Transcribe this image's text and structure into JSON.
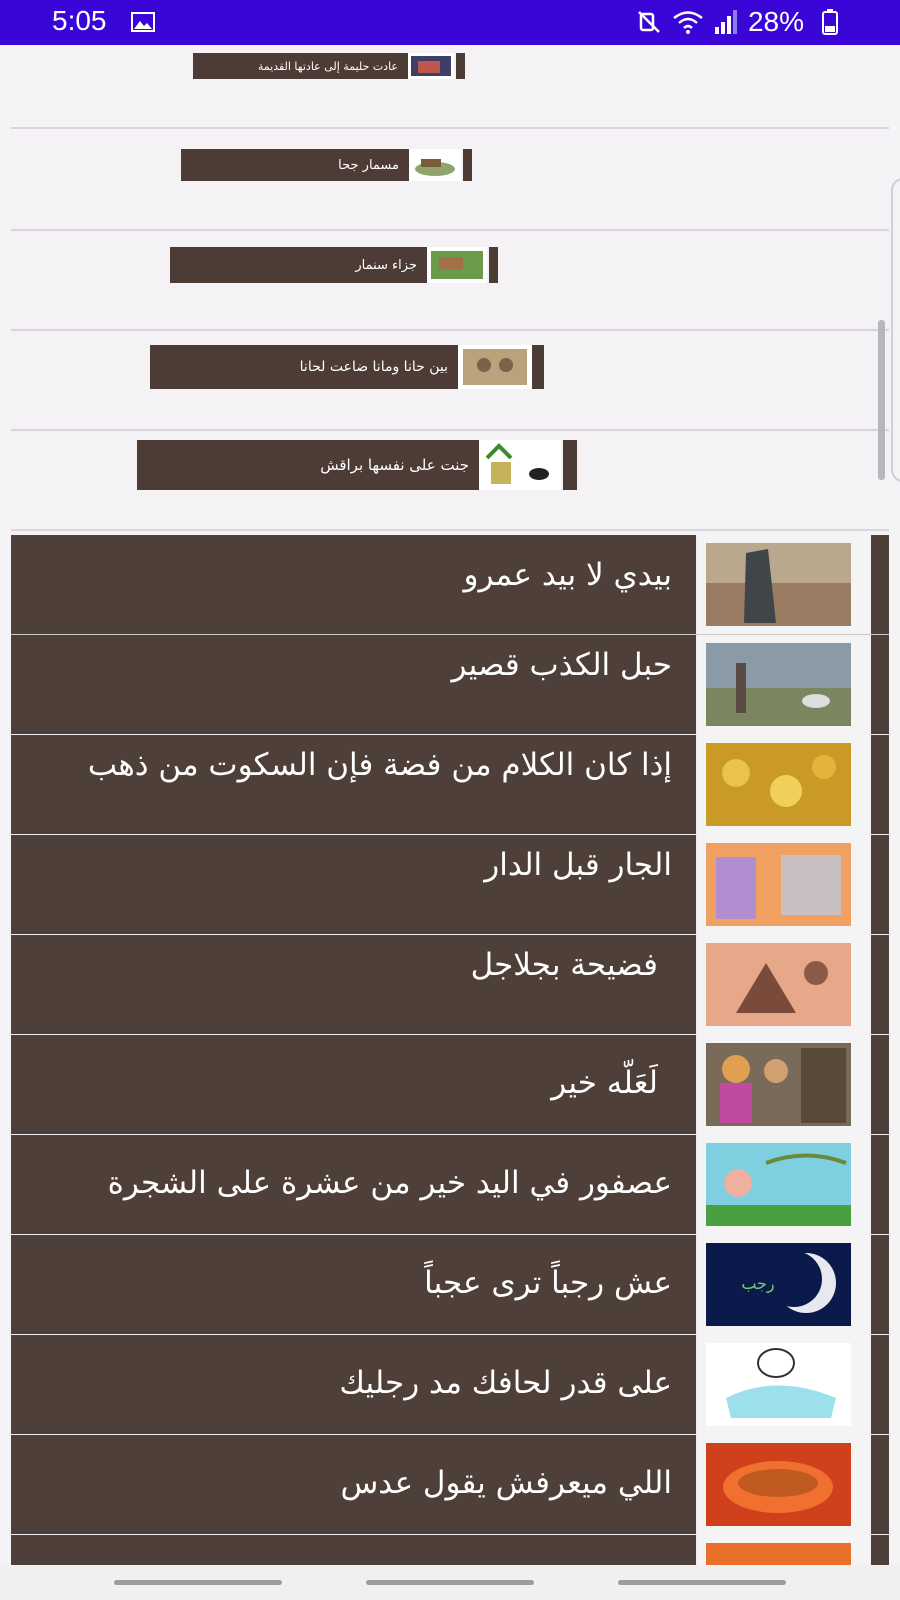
{
  "status": {
    "time": "5:05",
    "battery": "28%",
    "icons": [
      "image-icon",
      "mute-icon",
      "wifi-icon",
      "signal-icon",
      "battery-icon"
    ]
  },
  "small_items": [
    {
      "label": "عادت حليمة إلى عادتها القديمة"
    },
    {
      "label": "مسمار جحا"
    },
    {
      "label": "جزاء سنمار"
    },
    {
      "label": "بين حانا ومانا ضاعت لحانا"
    },
    {
      "label": "جنت على نفسها  براقش"
    }
  ],
  "big_items": [
    {
      "label": "بيدي لا بيد عمرو"
    },
    {
      "label": "حبل الكذب قصير"
    },
    {
      "label": "إذا كان الكلام من فضة فإن السكوت من ذهب"
    },
    {
      "label": "الجار قبل الدار"
    },
    {
      "label": "فضيحة بجلاجل"
    },
    {
      "label": "لَعَلّه خير"
    },
    {
      "label": "عصفور في اليد خير من عشرة على الشجرة"
    },
    {
      "label": "عش رجباً ترى عجباً",
      "thumb_text": "رجب"
    },
    {
      "label": "على قدر لحافك مد رجليك"
    },
    {
      "label": "اللي ميعرفش يقول عدس"
    }
  ],
  "colors": {
    "status_bar": "#3a06d8",
    "row_brown": "#4f3f39",
    "list_bg": "#f5f2f6"
  }
}
